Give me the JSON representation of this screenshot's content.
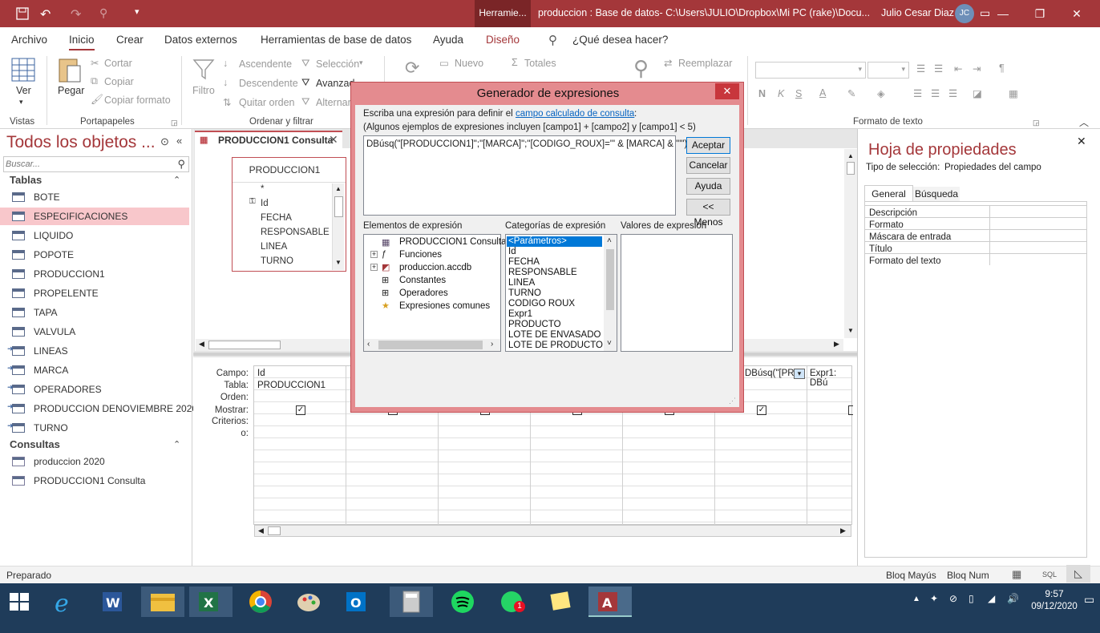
{
  "titlebar": {
    "context_tab": "Herramie...",
    "title": "produccion : Base de datos- C:\\Users\\JULIO\\Dropbox\\Mi PC (rake)\\Docu...",
    "user": "Julio Cesar Diaz",
    "avatar": "JC"
  },
  "menu": {
    "tabs": [
      "Archivo",
      "Inicio",
      "Crear",
      "Datos externos",
      "Herramientas de base de datos",
      "Ayuda",
      "Diseño"
    ],
    "search": "¿Qué desea hacer?"
  },
  "ribbon": {
    "ver": "Ver",
    "pegar": "Pegar",
    "cortar": "Cortar",
    "copiar": "Copiar",
    "copiar_formato": "Copiar formato",
    "filtro": "Filtro",
    "ascendente": "Ascendente",
    "descendente": "Descendente",
    "quitar_orden": "Quitar orden",
    "seleccion": "Selección",
    "avanzadas": "Avanzad",
    "alternar": "Alternar",
    "nuevo": "Nuevo",
    "totales": "Totales",
    "reemplazar": "Reemplazar",
    "groups": {
      "vistas": "Vistas",
      "portapapeles": "Portapapeles",
      "ordenar": "Ordenar y filtrar",
      "formato": "Formato de texto"
    }
  },
  "nav": {
    "title": "Todos los objetos ...",
    "search_placeholder": "Buscar...",
    "tablas_header": "Tablas",
    "consultas_header": "Consultas",
    "tablas": [
      "BOTE",
      "ESPECIFICACIONES",
      "LIQUIDO",
      "POPOTE",
      "PRODUCCION1",
      "PROPELENTE",
      "TAPA",
      "VALVULA",
      "LINEAS",
      "MARCA",
      "OPERADORES",
      "PRODUCCION  DENOVIEMBRE 2020",
      "TURNO"
    ],
    "consultas": [
      "produccion 2020",
      "PRODUCCION1 Consulta"
    ]
  },
  "query": {
    "tab": "PRODUCCION1 Consulta",
    "table_name": "PRODUCCION1",
    "fields": [
      "*",
      "Id",
      "FECHA",
      "RESPONSABLE",
      "LINEA",
      "TURNO"
    ],
    "grid_labels": [
      "Campo:",
      "Tabla:",
      "Orden:",
      "Mostrar:",
      "Criterios:",
      "o:"
    ],
    "col1_field": "Id",
    "col1_table": "PRODUCCION1",
    "col7_field": "DBúsq(\"[PR",
    "col8_field": "Expr1: DBú"
  },
  "props": {
    "title": "Hoja de propiedades",
    "sel_label": "Tipo de selección:",
    "sel_value": "Propiedades del campo",
    "tab_general": "General",
    "tab_busqueda": "Búsqueda",
    "rows": [
      "Descripción",
      "Formato",
      "Máscara de entrada",
      "Título",
      "Formato del texto"
    ]
  },
  "dialog": {
    "title": "Generador de expresiones",
    "intro": "Escriba una expresión para definir el",
    "link": "campo calculado de consulta",
    "intro_end": ":",
    "examples": "(Algunos ejemplos de expresiones incluyen [campo1] + [campo2] y [campo1] < 5)",
    "expression": "DBúsq(\"[PRODUCCION1]\";\"[MARCA]\";\"[CODIGO_ROUX]='\" & [MARCA] & \"'\")",
    "btn_aceptar": "Aceptar",
    "btn_cancelar": "Cancelar",
    "btn_ayuda": "Ayuda",
    "btn_menos": "<< Menos",
    "lbl_elementos": "Elementos de expresión",
    "lbl_categorias": "Categorías de expresión",
    "lbl_valores": "Valores de expresión",
    "elementos": [
      "PRODUCCION1 Consulta",
      "Funciones",
      "produccion.accdb",
      "Constantes",
      "Operadores",
      "Expresiones comunes"
    ],
    "categorias": [
      "<Parámetros>",
      "Id",
      "FECHA",
      "RESPONSABLE",
      "LINEA",
      "TURNO",
      "CODIGO ROUX",
      "Expr1",
      "PRODUCTO",
      "LOTE DE ENVASADO",
      "LOTE DE PRODUCTO"
    ]
  },
  "status": {
    "left": "Preparado",
    "bloq_mayus": "Bloq Mayús",
    "bloq_num": "Bloq Num",
    "sql": "SQL"
  },
  "taskbar": {
    "time": "9:57",
    "date": "09/12/2020",
    "badge": "1"
  }
}
